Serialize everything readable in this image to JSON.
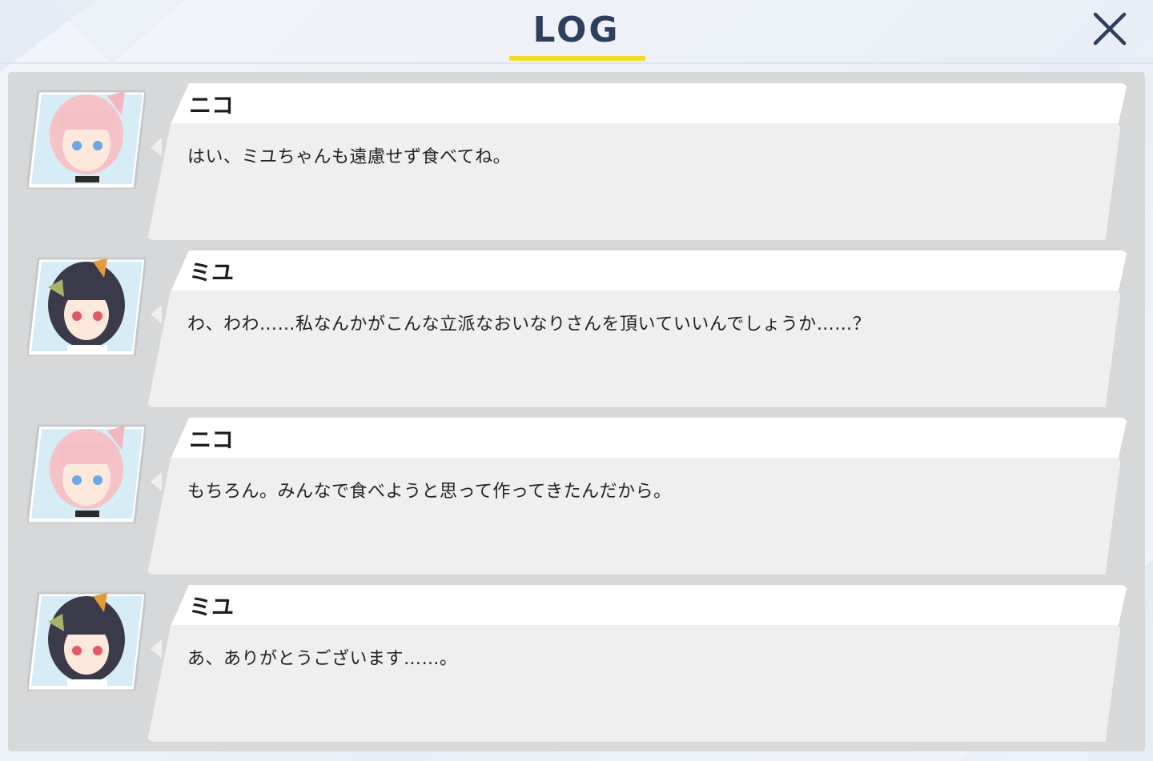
{
  "header": {
    "title": "LOG"
  },
  "colors": {
    "title_color": "#2e3f5e",
    "accent_underline": "#f2dc2a",
    "panel_bg": "#d7d8d9",
    "name_bubble_bg": "#ffffff",
    "message_bubble_bg": "#efefef"
  },
  "icons": {
    "close": "close-icon"
  },
  "log": [
    {
      "speaker": "ニコ",
      "avatar": "niko-portrait",
      "message": "はい、ミユちゃんも遠慮せず食べてね。"
    },
    {
      "speaker": "ミユ",
      "avatar": "miyu-portrait",
      "message": "わ、わわ……私なんかがこんな立派なおいなりさんを頂いていいんでしょうか……？"
    },
    {
      "speaker": "ニコ",
      "avatar": "niko-portrait",
      "message": "もちろん。みんなで食べようと思って作ってきたんだから。"
    },
    {
      "speaker": "ミユ",
      "avatar": "miyu-portrait",
      "message": "あ、ありがとうございます……。"
    }
  ]
}
